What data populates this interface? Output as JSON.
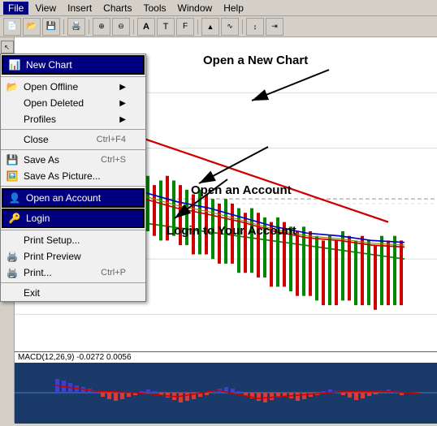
{
  "menubar": {
    "items": [
      "File",
      "View",
      "Insert",
      "Charts",
      "Tools",
      "Window",
      "Help"
    ],
    "active": "File"
  },
  "dropdown": {
    "items": [
      {
        "label": "New Chart",
        "shortcut": "",
        "hasIcon": true,
        "highlighted": true,
        "hasSub": false
      },
      {
        "label": "Open Offline",
        "shortcut": "",
        "hasIcon": false,
        "highlighted": false,
        "hasSub": true
      },
      {
        "label": "Open Deleted",
        "shortcut": "",
        "hasIcon": false,
        "highlighted": false,
        "hasSub": true
      },
      {
        "label": "Profiles",
        "shortcut": "",
        "hasIcon": false,
        "highlighted": false,
        "hasSub": true
      },
      {
        "label": "Close",
        "shortcut": "Ctrl+F4",
        "hasIcon": false,
        "highlighted": false,
        "hasSub": false
      },
      {
        "label": "Save As",
        "shortcut": "Ctrl+S",
        "hasIcon": true,
        "highlighted": false,
        "hasSub": false
      },
      {
        "label": "Save As Picture...",
        "shortcut": "",
        "hasIcon": true,
        "highlighted": false,
        "hasSub": false
      },
      {
        "label": "Open an Account",
        "shortcut": "",
        "hasIcon": true,
        "highlighted": true,
        "hasSub": false
      },
      {
        "label": "Login",
        "shortcut": "",
        "hasIcon": true,
        "highlighted": true,
        "hasSub": false
      },
      {
        "label": "Print Setup...",
        "shortcut": "",
        "hasIcon": false,
        "highlighted": false,
        "hasSub": false
      },
      {
        "label": "Print Preview",
        "shortcut": "",
        "hasIcon": true,
        "highlighted": false,
        "hasSub": false
      },
      {
        "label": "Print...",
        "shortcut": "Ctrl+P",
        "hasIcon": true,
        "highlighted": false,
        "hasSub": false
      },
      {
        "label": "Exit",
        "shortcut": "",
        "hasIcon": false,
        "highlighted": false,
        "hasSub": false
      }
    ]
  },
  "annotations": {
    "new_chart": "Open a New Chart",
    "open_account": "Open an Account",
    "login": "Login to Your Account"
  },
  "macd": {
    "label": "MACD(12,26,9) -0.0272 0.0056"
  },
  "toolbar": {
    "buttons": [
      "📂",
      "💾",
      "🖨️",
      "🔍",
      "📊",
      "🔧"
    ]
  }
}
